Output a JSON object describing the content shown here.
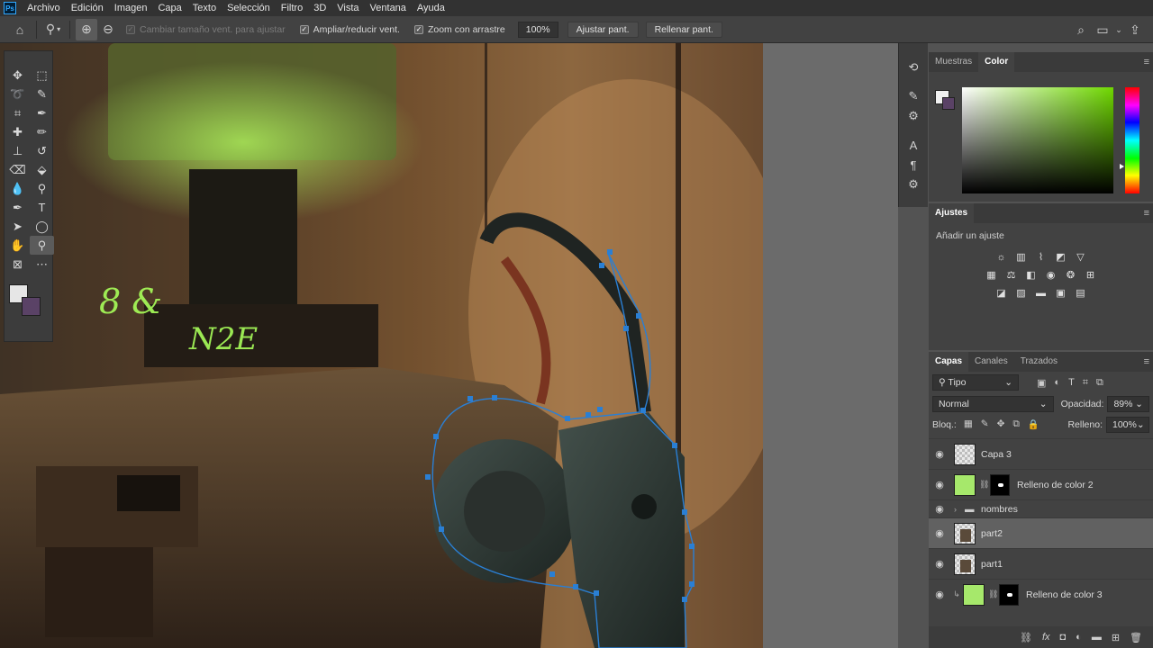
{
  "menu": [
    "Archivo",
    "Edición",
    "Imagen",
    "Capa",
    "Texto",
    "Selección",
    "Filtro",
    "3D",
    "Vista",
    "Ventana",
    "Ayuda"
  ],
  "app_logo": "Ps",
  "options": {
    "resize_windows_label": "Cambiar tamaño vent. para ajustar",
    "zoom_all_windows_label": "Ampliar/reducir vent.",
    "scrubby_zoom_label": "Zoom con arrastre",
    "zoom_value": "100%",
    "fit_screen_label": "Ajustar pant.",
    "fill_screen_label": "Rellenar pant."
  },
  "color_panel": {
    "tabs": [
      "Muestras",
      "Color"
    ],
    "active_tab": "Color",
    "foreground": "#f0f0f0",
    "background": "#5a4266",
    "hue_color": "#6fd800"
  },
  "adjustments": {
    "title": "Ajustes",
    "subtitle": "Añadir un ajuste"
  },
  "layers_panel": {
    "tabs": [
      "Capas",
      "Canales",
      "Trazados"
    ],
    "filter_label": "Tipo",
    "blend_mode": "Normal",
    "opacity_label": "Opacidad:",
    "opacity_value": "89%",
    "lock_label": "Bloq.:",
    "fill_label": "Relleno:",
    "fill_value": "100%",
    "layers": [
      {
        "name": "Capa 3",
        "selected": false
      },
      {
        "name": "Relleno de color 2",
        "selected": false
      },
      {
        "name": "nombres",
        "selected": false
      },
      {
        "name": "part2",
        "selected": true
      },
      {
        "name": "part1",
        "selected": false
      },
      {
        "name": "Relleno de color 3",
        "selected": false
      }
    ]
  }
}
